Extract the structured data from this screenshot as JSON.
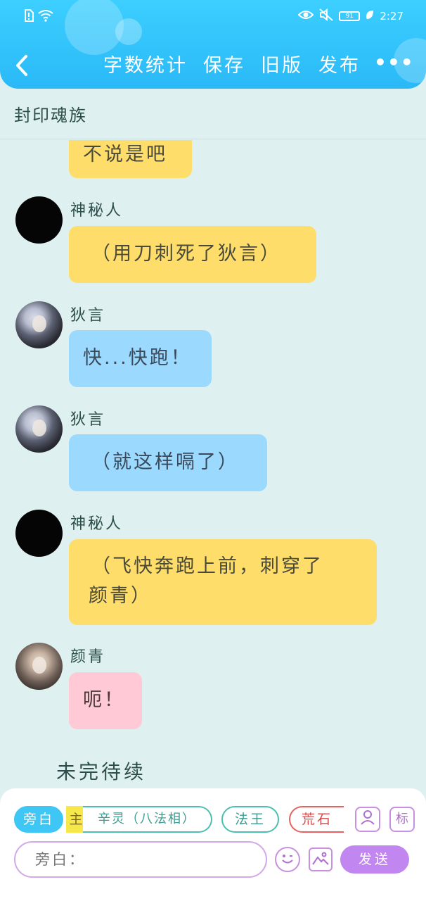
{
  "status_bar": {
    "left_icons": [
      "sim-alert-icon",
      "wifi-icon"
    ],
    "right_icons": [
      "eye-icon",
      "mute-icon",
      "leaf-icon"
    ],
    "battery_level": "91",
    "time": "2:27"
  },
  "header": {
    "back_icon": "chevron-left-icon",
    "actions": [
      "字数统计",
      "保存",
      "旧版",
      "发布"
    ],
    "more_label": "•••"
  },
  "chapter": {
    "title": "封印魂族"
  },
  "messages": [
    {
      "speaker": "",
      "text": "不说是吧",
      "color": "yellow"
    },
    {
      "speaker": "神秘人",
      "text": "（用刀刺死了狄言）",
      "color": "yellow"
    },
    {
      "speaker": "狄言",
      "text": "快...快跑！",
      "color": "blue"
    },
    {
      "speaker": "狄言",
      "text": "（就这样嗝了）",
      "color": "blue"
    },
    {
      "speaker": "神秘人",
      "text_line1": "（飞快奔跑上前，刺穿了",
      "text_line2": "颜青）",
      "color": "yellow"
    },
    {
      "speaker": "颜青",
      "text": "呃！",
      "color": "pink"
    }
  ],
  "footer_note": "未完待续",
  "composer": {
    "roles": [
      "旁白",
      "主",
      "辛灵（八法相）",
      "法王",
      "荒石"
    ],
    "side_icons": [
      "character-card-icon",
      "标"
    ],
    "input_placeholder": "旁白：",
    "emoji_icon": "smiley-icon",
    "image_icon": "image-icon",
    "send_label": "发送"
  },
  "colors": {
    "header": "#2ab9f7",
    "background": "#dff0f0",
    "bubble_yellow": "#ffdd6b",
    "bubble_blue": "#9bd9ff",
    "bubble_pink": "#ffc9d6",
    "send_button": "#c286f0"
  }
}
